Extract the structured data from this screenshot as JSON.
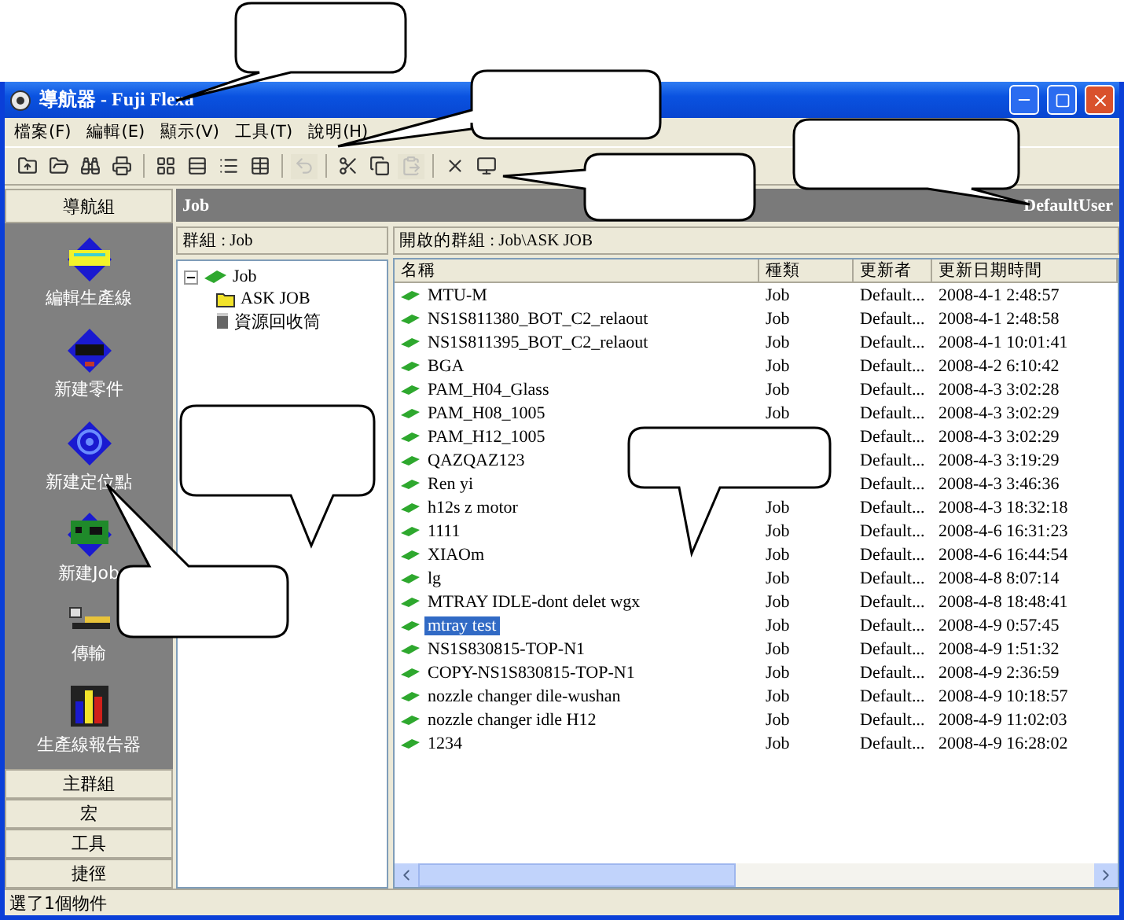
{
  "window": {
    "title": "導航器 - Fuji Flexa"
  },
  "menu": [
    "檔案(F)",
    "編輯(E)",
    "顯示(V)",
    "工具(T)",
    "說明(H)"
  ],
  "toolbar": [
    [
      {
        "kind": "new-folder",
        "disabled": false
      },
      {
        "kind": "open",
        "disabled": false
      },
      {
        "kind": "find",
        "disabled": false
      },
      {
        "kind": "print",
        "disabled": false
      }
    ],
    [
      {
        "kind": "large-icons",
        "disabled": false
      },
      {
        "kind": "small-icons",
        "disabled": false
      },
      {
        "kind": "list",
        "disabled": false
      },
      {
        "kind": "details",
        "disabled": false
      }
    ],
    [
      {
        "kind": "undo",
        "disabled": true
      }
    ],
    [
      {
        "kind": "cut",
        "disabled": false
      },
      {
        "kind": "copy",
        "disabled": false
      },
      {
        "kind": "paste",
        "disabled": true
      }
    ],
    [
      {
        "kind": "delete",
        "disabled": false
      },
      {
        "kind": "properties",
        "disabled": false
      }
    ]
  ],
  "sidebar": {
    "header": "導航組",
    "items": [
      {
        "kind": "line",
        "label": "編輯生產線"
      },
      {
        "kind": "part",
        "label": "新建零件"
      },
      {
        "kind": "mark",
        "label": "新建定位點"
      },
      {
        "kind": "job",
        "label": "新建Job"
      },
      {
        "kind": "transfer",
        "label": "傳輸"
      },
      {
        "kind": "report",
        "label": "生產線報告器"
      }
    ],
    "sections": [
      "主群組",
      "宏",
      "工具",
      "捷徑"
    ]
  },
  "content_header": {
    "title": "Job",
    "user": "DefaultUser"
  },
  "tree": {
    "header": "群組 : Job",
    "items": [
      {
        "kind": "job",
        "label": "Job",
        "expanded": true,
        "children": [
          {
            "kind": "folder",
            "label": "ASK JOB"
          },
          {
            "kind": "trash",
            "label": "資源回收筒"
          }
        ]
      }
    ]
  },
  "list": {
    "header": "開啟的群組 : Job\\ASK JOB",
    "columns": [
      "名稱",
      "種類",
      "更新者",
      "更新日期時間"
    ],
    "rows": [
      {
        "name": "MTU-M",
        "type": "Job",
        "user": "Default...",
        "date": "2008-4-1 2:48:57",
        "selected": false
      },
      {
        "name": "NS1S811380_BOT_C2_relaout",
        "type": "Job",
        "user": "Default...",
        "date": "2008-4-1 2:48:58",
        "selected": false
      },
      {
        "name": "NS1S811395_BOT_C2_relaout",
        "type": "Job",
        "user": "Default...",
        "date": "2008-4-1 10:01:41",
        "selected": false
      },
      {
        "name": "BGA",
        "type": "Job",
        "user": "Default...",
        "date": "2008-4-2 6:10:42",
        "selected": false
      },
      {
        "name": "PAM_H04_Glass",
        "type": "Job",
        "user": "Default...",
        "date": "2008-4-3 3:02:28",
        "selected": false
      },
      {
        "name": "PAM_H08_1005",
        "type": "Job",
        "user": "Default...",
        "date": "2008-4-3 3:02:29",
        "selected": false
      },
      {
        "name": "PAM_H12_1005",
        "user": "Default...",
        "date": "2008-4-3 3:02:29",
        "selected": false
      },
      {
        "name": "QAZQAZ123",
        "user": "Default...",
        "date": "2008-4-3 3:19:29",
        "selected": false
      },
      {
        "name": "Ren yi",
        "user": "Default...",
        "date": "2008-4-3 3:46:36",
        "selected": false
      },
      {
        "name": "h12s z motor",
        "type": "Job",
        "user": "Default...",
        "date": "2008-4-3 18:32:18",
        "selected": false
      },
      {
        "name": "1111",
        "type": "Job",
        "user": "Default...",
        "date": "2008-4-6 16:31:23",
        "selected": false
      },
      {
        "name": "XIAOm",
        "type": "Job",
        "user": "Default...",
        "date": "2008-4-6 16:44:54",
        "selected": false
      },
      {
        "name": "lg",
        "type": "Job",
        "user": "Default...",
        "date": "2008-4-8 8:07:14",
        "selected": false
      },
      {
        "name": "MTRAY IDLE-dont delet  wgx",
        "type": "Job",
        "user": "Default...",
        "date": "2008-4-8 18:48:41",
        "selected": false
      },
      {
        "name": "mtray test",
        "type": "Job",
        "user": "Default...",
        "date": "2008-4-9 0:57:45",
        "selected": true
      },
      {
        "name": "NS1S830815-TOP-N1",
        "type": "Job",
        "user": "Default...",
        "date": "2008-4-9 1:51:32",
        "selected": false
      },
      {
        "name": "COPY-NS1S830815-TOP-N1",
        "type": "Job",
        "user": "Default...",
        "date": "2008-4-9 2:36:59",
        "selected": false
      },
      {
        "name": "nozzle changer dile-wushan",
        "type": "Job",
        "user": "Default...",
        "date": "2008-4-9 10:18:57",
        "selected": false
      },
      {
        "name": "nozzle changer idle H12",
        "type": "Job",
        "user": "Default...",
        "date": "2008-4-9 11:02:03",
        "selected": false
      },
      {
        "name": "1234",
        "type": "Job",
        "user": "Default...",
        "date": "2008-4-9 16:28:02",
        "selected": false
      }
    ]
  },
  "status_bar": "選了1個物件"
}
